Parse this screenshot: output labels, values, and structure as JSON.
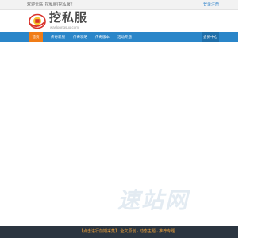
{
  "topbar": {
    "welcome": "欢迎光临_挖私服(挖私服)!",
    "login": "登录注册"
  },
  "logo": {
    "title": "挖私服",
    "domain": "waslgongsuo.com"
  },
  "nav": {
    "items": [
      {
        "label": "首页",
        "active": true
      },
      {
        "label": "传奇新服",
        "active": false
      },
      {
        "label": "传奇攻略",
        "active": false
      },
      {
        "label": "传奇版本",
        "active": false
      },
      {
        "label": "活动专题",
        "active": false
      }
    ],
    "right_label": "会员中心"
  },
  "watermark": "速站网",
  "footer": {
    "promo": "【点击进行前期采集】 全文原创 · 动态主题 · 推荐专题"
  },
  "colors": {
    "nav_bg": "#2a86c9",
    "nav_active": "#f07c17",
    "footer_bg": "#2b3540",
    "logo_red": "#d9322a",
    "logo_gold": "#f4c430"
  }
}
